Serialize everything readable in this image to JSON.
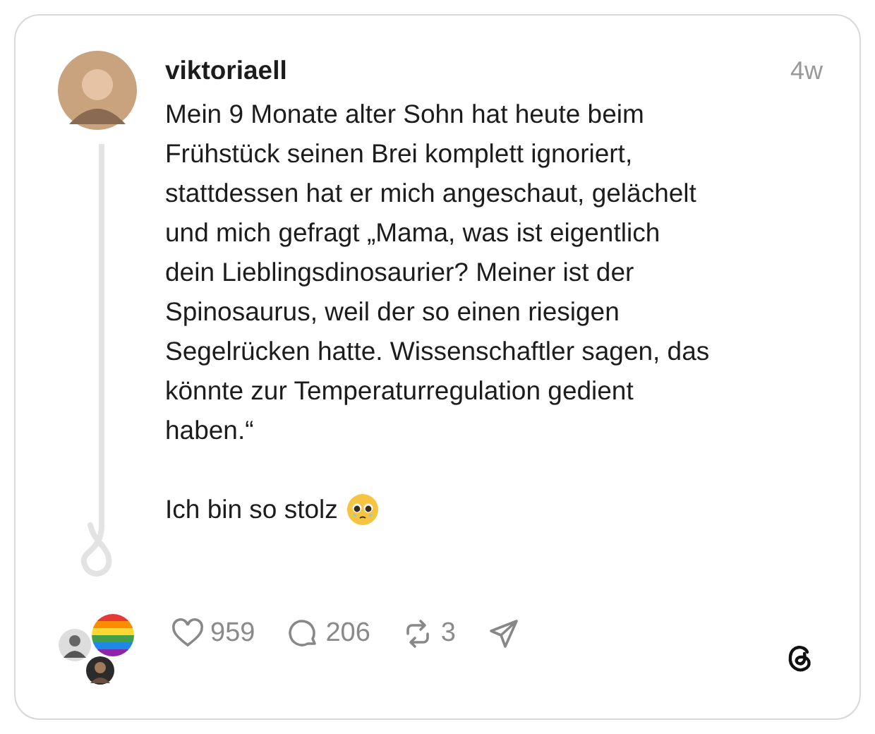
{
  "post": {
    "author": "viktoriaell",
    "time": "4w",
    "body": "Mein 9 Monate alter Sohn hat heute beim\nFrühstück seinen Brei komplett ignoriert,\nstattdessen hat er mich angeschaut, gelächelt\nund mich gefragt „Mama, was ist eigentlich\ndein Lieblingsdinosaurier? Meiner ist der\nSpinosaurus, weil der so einen riesigen\nSegelrücken hatte. Wissenschaftler sagen, das\nkönnte zur Temperaturregulation gedient\nhaben.“",
    "closing": "Ich bin so stolz",
    "actions": [
      {
        "kind": "like",
        "count": "959"
      },
      {
        "kind": "reply",
        "count": "206"
      },
      {
        "kind": "repost",
        "count": "3"
      },
      {
        "kind": "share"
      }
    ]
  }
}
